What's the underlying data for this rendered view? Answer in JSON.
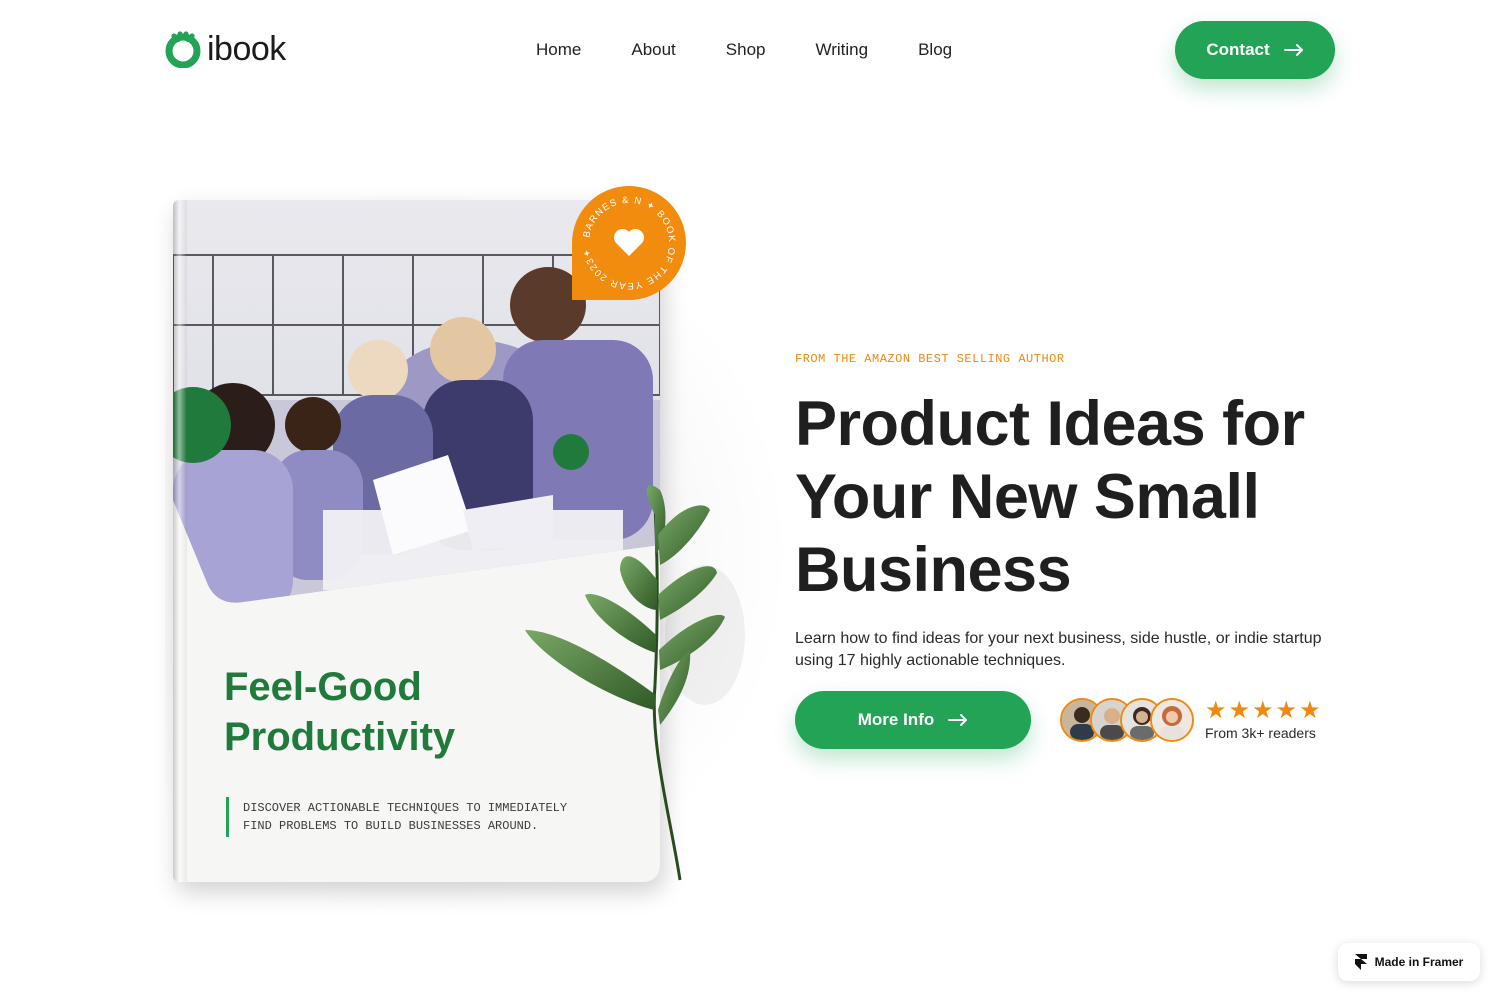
{
  "brand": {
    "name": "ibook",
    "accent": "#22a355",
    "secondary": "#ef8a11"
  },
  "nav": {
    "items": [
      {
        "label": "Home"
      },
      {
        "label": "About"
      },
      {
        "label": "Shop"
      },
      {
        "label": "Writing"
      },
      {
        "label": "Blog"
      }
    ],
    "contact_label": "Contact",
    "contact_icon": "arrow-right-icon"
  },
  "book": {
    "title_line1": "Feel-Good",
    "title_line2": "Productivity",
    "description_line1": "DISCOVER ACTIONABLE TECHNIQUES TO IMMEDIATELY",
    "description_line2": "FIND PROBLEMS TO BUILD BUSINESSES AROUND.",
    "badge_text": "BARNES & N ✦ BOOK OF THE YEAR 2023✦",
    "badge_icon": "heart-icon"
  },
  "hero": {
    "eyebrow": "FROM THE AMAZON BEST SELLING AUTHOR",
    "headline_line1": "Product Ideas for",
    "headline_line2": "Your New Small",
    "headline_line3": "Business",
    "subtitle": "Learn how to find ideas for your next business, side hustle, or indie startup using 17 highly actionable techniques.",
    "cta_label": "More Info",
    "cta_icon": "arrow-right-icon",
    "rating": 5,
    "readers": "From 3k+ readers"
  },
  "framer_badge": {
    "label": "Made in Framer",
    "icon": "framer-logo-icon"
  }
}
